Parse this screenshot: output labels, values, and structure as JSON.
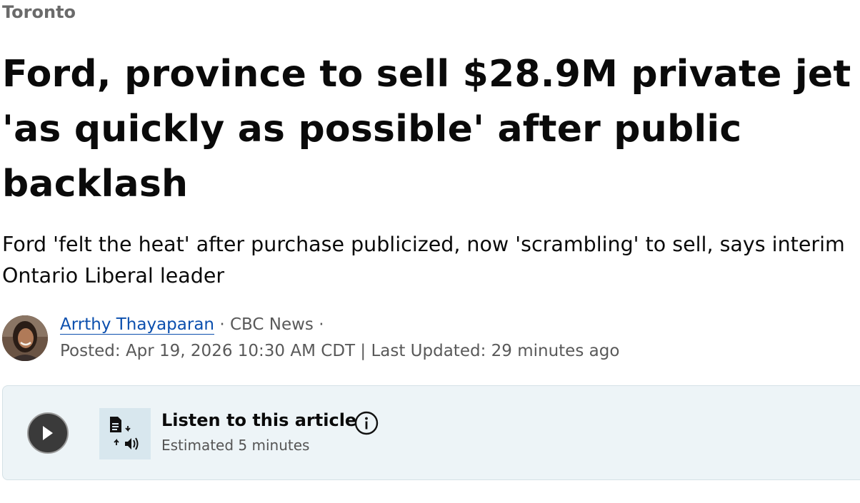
{
  "section": {
    "label": "Toronto"
  },
  "article": {
    "headline": "Ford, province to sell $28.9M private jet 'as quickly as possible' after public backlash",
    "deck": "Ford 'felt the heat' after purchase publicized, now 'scrambling' to sell, says interim Ontario Liberal leader"
  },
  "byline": {
    "author": "Arrthy Thayaparan",
    "separator": "·",
    "outlet": "CBC News",
    "posted_label": "Posted:",
    "posted": "Apr 19, 2026 10:30 AM CDT",
    "divider": "|",
    "updated_label": "Last Updated:",
    "updated": "29 minutes ago"
  },
  "listen": {
    "title": "Listen to this article",
    "subtitle": "Estimated 5 minutes",
    "icons": {
      "play": "play-icon",
      "tts": "text-to-speech-icon",
      "info": "info-icon"
    }
  },
  "colors": {
    "link": "#0b4fae",
    "section": "#6a6a6a",
    "listen_bg": "#edf4f7",
    "play_bg": "#3a3a3a"
  }
}
